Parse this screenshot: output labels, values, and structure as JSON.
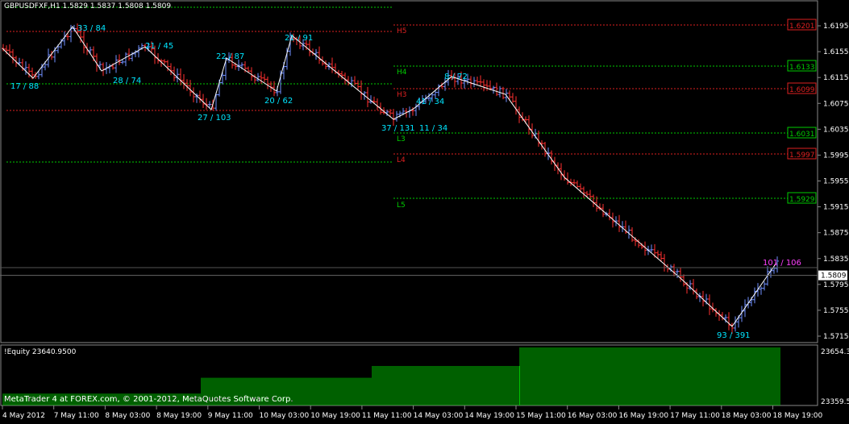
{
  "chart_header": {
    "symbol_title": "GBPUSDFXF,H1  1.5829 1.5837 1.5808 1.5809"
  },
  "equity": {
    "title": "!Equity 23640.9500",
    "axis_top": "23654.3",
    "axis_bottom": "23359.5",
    "levels": [
      23359.5,
      23420,
      23500,
      23560,
      23654.3
    ],
    "color": "#00c000"
  },
  "copyright": "MetaTrader 4 at FOREX.com, © 2001-2012, MetaQuotes Software Corp.",
  "colors": {
    "background": "#000000",
    "bull_bar": "#6f8fff",
    "bear_bar": "#ff3030",
    "zigzag": "#ffffff",
    "support": "#00cc00",
    "resistance": "#dd2020",
    "wave_label": "#00e5ff",
    "last_wave_label": "#ff40ff"
  },
  "price_axis": {
    "ticks": [
      "1.6195",
      "1.6155",
      "1.6115",
      "1.6075",
      "1.6035",
      "1.5995",
      "1.5955",
      "1.5915",
      "1.5875",
      "1.5835",
      "1.5795",
      "1.5755",
      "1.5715"
    ],
    "current_price": "1.5809"
  },
  "time_axis": {
    "labels": [
      "4 May 2012",
      "7 May 11:00",
      "8 May 03:00",
      "8 May 19:00",
      "9 May 11:00",
      "10 May 03:00",
      "10 May 19:00",
      "11 May 11:00",
      "14 May 03:00",
      "14 May 19:00",
      "15 May 11:00",
      "16 May 03:00",
      "16 May 19:00",
      "17 May 11:00",
      "18 May 03:00",
      "18 May 19:00"
    ]
  },
  "pivot_levels": [
    {
      "name": "H5",
      "value": "1.6201",
      "kind": "resistance"
    },
    {
      "name": "H4",
      "value": "1.6133",
      "kind": "support"
    },
    {
      "name": "H3",
      "value": "1.6099",
      "kind": "resistance"
    },
    {
      "name": "L3",
      "value": "1.6031",
      "kind": "support"
    },
    {
      "name": "L4",
      "value": "1.5997",
      "kind": "resistance"
    },
    {
      "name": "L5",
      "value": "1.5929",
      "kind": "support"
    }
  ],
  "wave_labels": [
    "17 / 88",
    "33 / 84",
    "28 / 74",
    "21 / 45",
    "27 / 103",
    "22 / 87",
    "20 / 62",
    "21 / 91",
    "37 / 131",
    "41 / 34",
    "11 / 34",
    "8 / 72",
    "93 / 391",
    "101 / 106"
  ]
}
